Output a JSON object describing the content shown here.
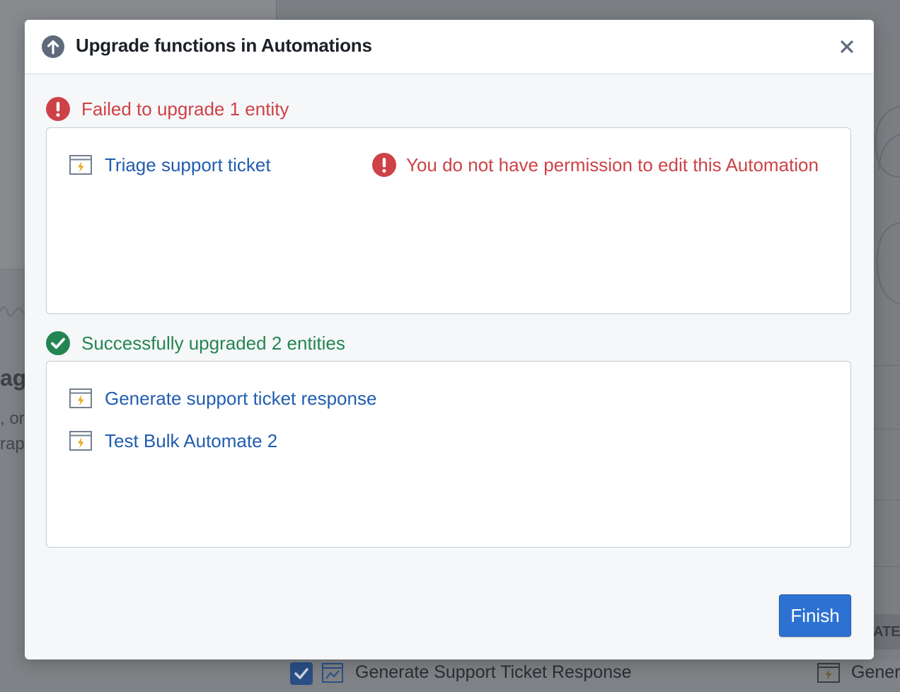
{
  "background": {
    "left_heading": "ag",
    "left_line1": ", or",
    "left_line2": "rap",
    "right_table_header": "ATE",
    "bottom_row": {
      "label": "Generate Support Ticket Response",
      "label_right": "Gener"
    }
  },
  "dialog": {
    "title": "Upgrade functions in Automations",
    "header_icon": "arrow-up-circle-icon",
    "close_icon": "close-icon",
    "failed": {
      "heading": "Failed to upgrade 1 entity",
      "icon": "error-icon",
      "items": [
        {
          "label": "Triage support ticket",
          "icon": "automation-icon",
          "error": "You do not have permission to edit this Automation"
        }
      ]
    },
    "success": {
      "heading": "Successfully upgraded 2 entities",
      "icon": "tick-circle-icon",
      "items": [
        {
          "label": "Generate support ticket response",
          "icon": "automation-icon"
        },
        {
          "label": "Test Bulk Automate 2",
          "icon": "automation-icon"
        }
      ]
    },
    "finish_label": "Finish"
  },
  "colors": {
    "error": "#cd4246",
    "success": "#238551",
    "link": "#215db0",
    "primary": "#2d72d2",
    "automation_bolt": "#e6a817"
  }
}
